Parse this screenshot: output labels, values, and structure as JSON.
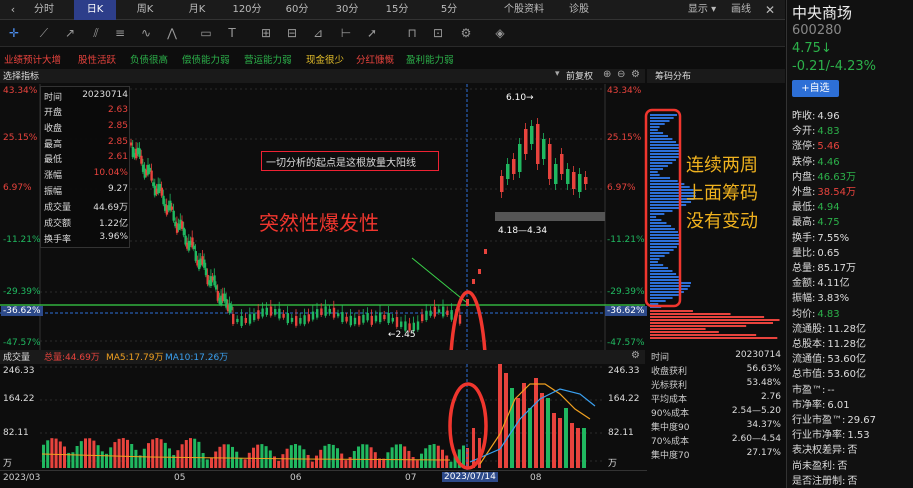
{
  "tabs": [
    "分时",
    "日K",
    "周K",
    "月K",
    "120分",
    "60分",
    "30分",
    "15分",
    "5分",
    "个股资料",
    "诊股"
  ],
  "top_right": {
    "show": "显示 ▾",
    "draw": "画线"
  },
  "tags": [
    {
      "label": "业绩预计大增",
      "color": "#e8433d"
    },
    {
      "label": "股性活跃",
      "color": "#e8433d"
    },
    {
      "label": "负债很高",
      "color": "#2cb14a"
    },
    {
      "label": "偿债能力弱",
      "color": "#2cb14a"
    },
    {
      "label": "营运能力弱",
      "color": "#2cb14a"
    },
    {
      "label": "现金很少",
      "color": "#e8c22b"
    },
    {
      "label": "分红慷慨",
      "color": "#e8433d"
    },
    {
      "label": "盈利能力弱",
      "color": "#2cb14a"
    }
  ],
  "main_header": {
    "indicator": "选择指标",
    "adjust": "前复权",
    "chips_title": "筹码分布"
  },
  "price_axis_left": [
    "43.34%",
    "25.15%",
    "6.97%",
    "-11.21%",
    "-29.39%",
    "-36.62%",
    "-47.57%"
  ],
  "price_axis_right": [
    "43.34%",
    "25.15%",
    "6.97%",
    "-11.21%",
    "-29.39%",
    "-36.62%",
    "-47.57%"
  ],
  "info_panel": [
    {
      "label": "时间",
      "value": "20230714",
      "color": "#ddd"
    },
    {
      "label": "开盘",
      "value": "2.63",
      "color": "#e8433d"
    },
    {
      "label": "收盘",
      "value": "2.85",
      "color": "#e8433d"
    },
    {
      "label": "最高",
      "value": "2.85",
      "color": "#e8433d"
    },
    {
      "label": "最低",
      "value": "2.61",
      "color": "#e8433d"
    },
    {
      "label": "涨幅",
      "value": "10.04%",
      "color": "#e8433d"
    },
    {
      "label": "振幅",
      "value": "9.27",
      "color": "#ddd"
    },
    {
      "label": "成交量",
      "value": "44.69万",
      "color": "#ddd"
    },
    {
      "label": "成交额",
      "value": "1.22亿",
      "color": "#ddd"
    },
    {
      "label": "换手率",
      "value": "3.96%",
      "color": "#ddd"
    }
  ],
  "annotations": {
    "box_text": "一切分析的起点是这根放量大阳线",
    "red_text": "突然性爆发性",
    "chip_text": [
      "连续两周",
      "上面筹码",
      "没有变动"
    ],
    "high_label": "6.10→",
    "low_label": "←2.45",
    "range_label": "4.18—4.34"
  },
  "volume_header": {
    "title": "成交量",
    "total": "总量:44.69万",
    "ma5": "MA5:17.79万",
    "ma10": "MA10:17.26万"
  },
  "volume_axis_left": [
    "246.33",
    "164.22",
    "82.11",
    "万"
  ],
  "volume_axis_right": [
    "246.33",
    "164.22",
    "82.11",
    "万"
  ],
  "date_axis": [
    "2023/03",
    "05",
    "06",
    "07",
    "2023/07/14",
    "08"
  ],
  "stock": {
    "name": "中央商场",
    "code": "600280",
    "price": "4.75↓",
    "change": "-0.21/-4.23%",
    "add_btn": "+自选"
  },
  "quote_rows": [
    {
      "label": "昨收:",
      "value": "4.96",
      "color": "#ddd"
    },
    {
      "label": "今开:",
      "value": "4.83",
      "color": "#2cb14a"
    },
    {
      "label": "涨停:",
      "value": "5.46",
      "color": "#e8433d"
    },
    {
      "label": "跌停:",
      "value": "4.46",
      "color": "#2cb14a"
    },
    {
      "label": "内盘:",
      "value": "46.63万",
      "color": "#2cb14a"
    },
    {
      "label": "外盘:",
      "value": "38.54万",
      "color": "#e8433d"
    },
    {
      "label": "最低:",
      "value": "4.94",
      "color": "#2cb14a"
    },
    {
      "label": "最高:",
      "value": "4.75",
      "color": "#2cb14a"
    },
    {
      "label": "换手:",
      "value": "7.55%",
      "color": "#ddd"
    },
    {
      "label": "量比:",
      "value": "0.65",
      "color": "#ddd"
    },
    {
      "label": "总量:",
      "value": "85.17万",
      "color": "#ddd"
    },
    {
      "label": "金额:",
      "value": "4.11亿",
      "color": "#ddd"
    },
    {
      "label": "振幅:",
      "value": "3.83%",
      "color": "#ddd"
    },
    {
      "label": "均价:",
      "value": "4.83",
      "color": "#2cb14a"
    },
    {
      "label": "流通股:",
      "value": "11.28亿",
      "color": "#ddd"
    },
    {
      "label": "总股本:",
      "value": "11.28亿",
      "color": "#ddd"
    },
    {
      "label": "流通值:",
      "value": "53.60亿",
      "color": "#ddd"
    },
    {
      "label": "总市值:",
      "value": "53.60亿",
      "color": "#ddd"
    },
    {
      "label": "市盈™:",
      "value": "--",
      "color": "#ddd"
    },
    {
      "label": "市净率:",
      "value": "6.01",
      "color": "#ddd"
    },
    {
      "label": "行业市盈™:",
      "value": "29.67",
      "color": "#ddd"
    },
    {
      "label": "行业市净率:",
      "value": "1.53",
      "color": "#ddd"
    },
    {
      "label": "表决权差异:",
      "value": "否",
      "color": "#ddd"
    },
    {
      "label": "尚未盈利:",
      "value": "否",
      "color": "#ddd"
    },
    {
      "label": "是否注册制:",
      "value": "否",
      "color": "#ddd"
    }
  ],
  "chip_stats": [
    {
      "label": "时间",
      "value": "20230714"
    },
    {
      "label": "收盘获利",
      "value": "56.63%"
    },
    {
      "label": "光标获利",
      "value": "53.48%"
    },
    {
      "label": "平均成本",
      "value": "2.76"
    },
    {
      "label": "90%成本",
      "value": "2.54—5.20"
    },
    {
      "label": "集中度90",
      "value": "34.37%"
    },
    {
      "label": "70%成本",
      "value": "2.60—4.54"
    },
    {
      "label": "集中度70",
      "value": "27.17%"
    }
  ],
  "colors": {
    "up": "#e8433d",
    "down": "#20b860",
    "accent": "#2d6fd6",
    "annotation": "#f0362e",
    "chip_text": "#f0b21e"
  }
}
